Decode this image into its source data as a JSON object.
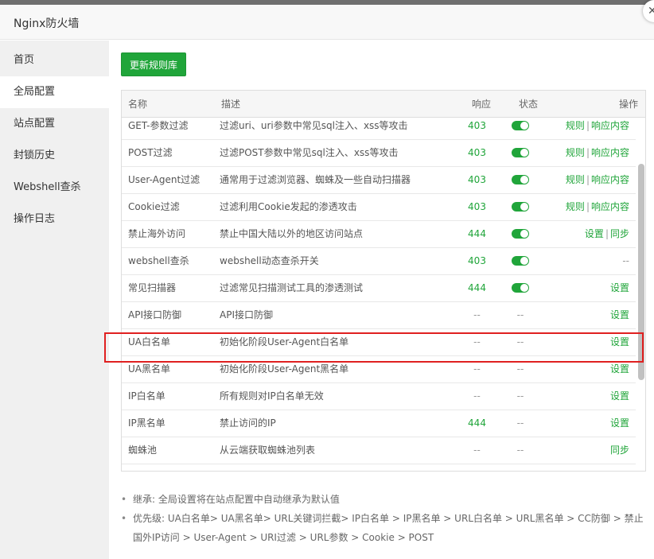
{
  "window": {
    "title": "Nginx防火墙",
    "close_glyph": "✕"
  },
  "sidebar": {
    "items": [
      {
        "label": "首页",
        "active": false
      },
      {
        "label": "全局配置",
        "active": true
      },
      {
        "label": "站点配置",
        "active": false
      },
      {
        "label": "封锁历史",
        "active": false
      },
      {
        "label": "Webshell查杀",
        "active": false
      },
      {
        "label": "操作日志",
        "active": false
      }
    ]
  },
  "toolbar": {
    "update_label": "更新规则库"
  },
  "table": {
    "headers": {
      "name": "名称",
      "desc": "描述",
      "code": "响应",
      "status": "状态",
      "ops": "操作"
    },
    "rows": [
      {
        "name": "GET-参数过滤",
        "desc": "过滤uri、uri参数中常见sql注入、xss等攻击",
        "code": "403",
        "status": "on",
        "ops": [
          "规则",
          "响应内容"
        ]
      },
      {
        "name": "POST过滤",
        "desc": "过滤POST参数中常见sql注入、xss等攻击",
        "code": "403",
        "status": "on",
        "ops": [
          "规则",
          "响应内容"
        ]
      },
      {
        "name": "User-Agent过滤",
        "desc": "通常用于过滤浏览器、蜘蛛及一些自动扫描器",
        "code": "403",
        "status": "on",
        "ops": [
          "规则",
          "响应内容"
        ]
      },
      {
        "name": "Cookie过滤",
        "desc": "过滤利用Cookie发起的渗透攻击",
        "code": "403",
        "status": "on",
        "ops": [
          "规则",
          "响应内容"
        ]
      },
      {
        "name": "禁止海外访问",
        "desc": "禁止中国大陆以外的地区访问站点",
        "code": "444",
        "status": "on",
        "ops": [
          "设置",
          "同步"
        ]
      },
      {
        "name": "webshell查杀",
        "desc": "webshell动态查杀开关",
        "code": "403",
        "status": "on",
        "ops": [
          "--"
        ]
      },
      {
        "name": "常见扫描器",
        "desc": "过滤常见扫描测试工具的渗透测试",
        "code": "444",
        "status": "on",
        "ops": [
          "设置"
        ]
      },
      {
        "name": "API接口防御",
        "desc": "API接口防御",
        "code": "--",
        "status": "--",
        "ops": [
          "设置"
        ]
      },
      {
        "name": "UA白名单",
        "desc": "初始化阶段User-Agent白名单",
        "code": "--",
        "status": "--",
        "ops": [
          "设置"
        ]
      },
      {
        "name": "UA黑名单",
        "desc": "初始化阶段User-Agent黑名单",
        "code": "--",
        "status": "--",
        "ops": [
          "设置"
        ]
      },
      {
        "name": "IP白名单",
        "desc": "所有规则对IP白名单无效",
        "code": "--",
        "status": "--",
        "ops": [
          "设置"
        ]
      },
      {
        "name": "IP黑名单",
        "desc": "禁止访问的IP",
        "code": "444",
        "status": "--",
        "ops": [
          "设置"
        ]
      },
      {
        "name": "蜘蛛池",
        "desc": "从云端获取蜘蛛池列表",
        "code": "--",
        "status": "--",
        "ops": [
          "同步"
        ]
      }
    ]
  },
  "notes": [
    "继承: 全局设置将在站点配置中自动继承为默认值",
    "优先级: UA白名单> UA黑名单> URL关键词拦截> IP白名单 > IP黑名单 > URL白名单 > URL黑名单 > CC防御 > 禁止国外IP访问 > User-Agent > URI过滤 > URL参数 > Cookie > POST"
  ],
  "colors": {
    "accent": "#20a53a",
    "highlight": "#e02020"
  }
}
